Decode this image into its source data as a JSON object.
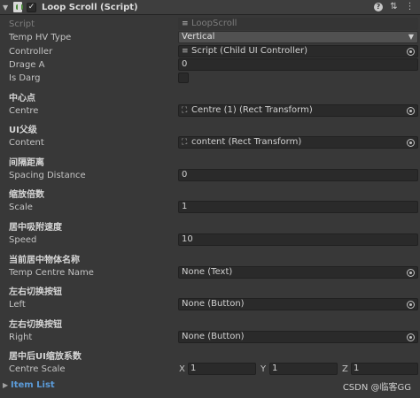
{
  "header": {
    "title": "Loop Scroll (Script)",
    "enabled_check": "✓"
  },
  "fields": {
    "script": {
      "label": "Script",
      "value": "LoopScroll"
    },
    "temp_hv_type": {
      "label": "Temp HV Type",
      "value": "Vertical"
    },
    "controller": {
      "label": "Controller",
      "value": "Script (Child UI Controller)"
    },
    "drage_a": {
      "label": "Drage A",
      "value": "0"
    },
    "is_darg": {
      "label": "Is Darg",
      "checked": false
    },
    "centre": {
      "heading": "中心点",
      "label": "Centre",
      "value": "Centre (1) (Rect Transform)"
    },
    "content": {
      "heading": "UI父级",
      "label": "Content",
      "value": "content (Rect Transform)"
    },
    "spacing": {
      "heading": "间隔距离",
      "label": "Spacing Distance",
      "value": "0"
    },
    "scale": {
      "heading": "缩放倍数",
      "label": "Scale",
      "value": "1"
    },
    "speed": {
      "heading": "居中吸附速度",
      "label": "Speed",
      "value": "10"
    },
    "temp_centre_name": {
      "heading": "当前居中物体名称",
      "label": "Temp Centre Name",
      "value": "None (Text)"
    },
    "left": {
      "heading": "左右切换按钮",
      "label": "Left",
      "value": "None (Button)"
    },
    "right": {
      "heading": "左右切换按钮",
      "label": "Right",
      "value": "None (Button)"
    },
    "centre_scale": {
      "heading": "居中后UI缩放系数",
      "label": "Centre Scale",
      "x_label": "X",
      "x": "1",
      "y_label": "Y",
      "y": "1",
      "z_label": "Z",
      "z": "1"
    }
  },
  "footer": {
    "label": "Item List"
  },
  "watermark": "CSDN @临客GG",
  "icons": {
    "foldout_open": "▼",
    "foldout_closed": "▶",
    "dropdown_arrow": "▼",
    "settings": "⚙",
    "presets": "⇅",
    "menu": "⋮",
    "transform": "⛶",
    "script": "≡"
  }
}
